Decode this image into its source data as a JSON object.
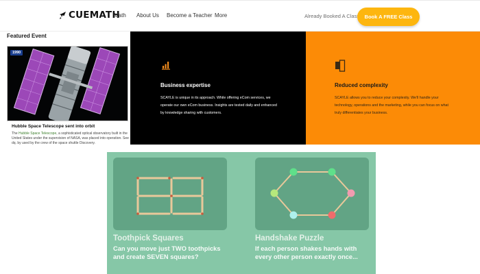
{
  "header": {
    "logo_text": "CUEMATH",
    "nav": [
      "Math",
      "About Us",
      "Become a Teacher",
      "More"
    ],
    "already_booked": "Already Booked A Class?",
    "cta_label": "Book A FREE Class"
  },
  "featured": {
    "heading": "Featured Event",
    "badge": "1990",
    "title": "Hubble Space Telescope sent into orbit",
    "desc_prefix": "The ",
    "desc_link": "Hubble Space Telescope",
    "desc_text": ", a sophisticated optical observatory built in the United States under the supervision of NASA, was placed into operation. See dq. by used by the crew of the space shuttle Discovery."
  },
  "features": {
    "business": {
      "title": "Business expertise",
      "body": "SCAYLE is unique in its approach. While offering eCom services, we operate our own eCom business. Insights are tested daily and enhanced by knowledge sharing with customers."
    },
    "reduced": {
      "title": "Reduced complexity",
      "body": "SCAYLE allows you to reduce your complexity. We'll handle your technology, operations and the marketing, while you can focus on what truly differentiates your business."
    }
  },
  "puzzles": [
    {
      "title": "Toothpick Squares",
      "desc": "Can you move just TWO toothpicks and create SEVEN squares?"
    },
    {
      "title": "Handshake Puzzle",
      "desc": "If each person shakes hands with every other person exactly once..."
    }
  ],
  "colors": {
    "cta": "#fdb60f",
    "orange_panel": "#fc8b06",
    "dark_panel": "#000000",
    "puzzle_bg": "#86c7a7",
    "puzzle_tile": "#62a485"
  },
  "icons": [
    "rocket-icon",
    "bar-chart-icon",
    "pages-icon"
  ]
}
